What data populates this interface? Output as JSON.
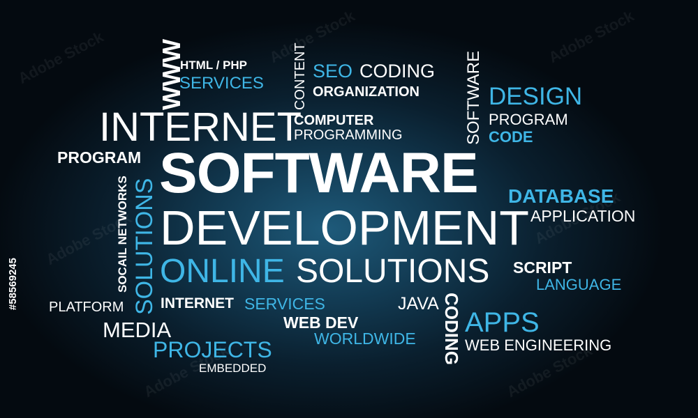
{
  "words": {
    "www": "WWW",
    "html_php": "HTML / PHP",
    "services_top": "SERVICES",
    "content": "CONTENT",
    "seo": "SEO",
    "coding": "CODING",
    "organization": "ORGANIZATION",
    "software_vert": "SOFTWARE",
    "design": "DESIGN",
    "program_right": "PROGRAM",
    "code": "CODE",
    "internet_big": "INTERNET",
    "computer": "COMPUTER",
    "programming": "PROGRAMMING",
    "program_left": "PROGRAM",
    "software_main": "SOFTWARE",
    "database": "DATABASE",
    "application": "APPLICATION",
    "development": "DEVELOPMENT",
    "social_networks": "SOCAIL NETWORKS",
    "solutions_vert": "SOLUTIONS",
    "online": "ONLINE",
    "solutions": "SOLUTIONS",
    "script": "SCRIPT",
    "language": "LANGUAGE",
    "platform": "PLATFORM",
    "internet_small": "INTERNET",
    "services_mid": "SERVICES",
    "java": "JAVA",
    "coding_vert": "CODING",
    "apps": "APPS",
    "media": "MEDIA",
    "web_dev": "WEB DEV",
    "worldwide": "WORLDWIDE",
    "web_engineering": "WEB ENGINEERING",
    "projects": "PROJECTS",
    "embedded": "EMBEDDED"
  },
  "stock_id": "#58569245",
  "watermark": "Adobe Stock",
  "colors": {
    "white": "#ffffff",
    "blue": "#3fb6e6",
    "background": "#0a1f2e"
  }
}
